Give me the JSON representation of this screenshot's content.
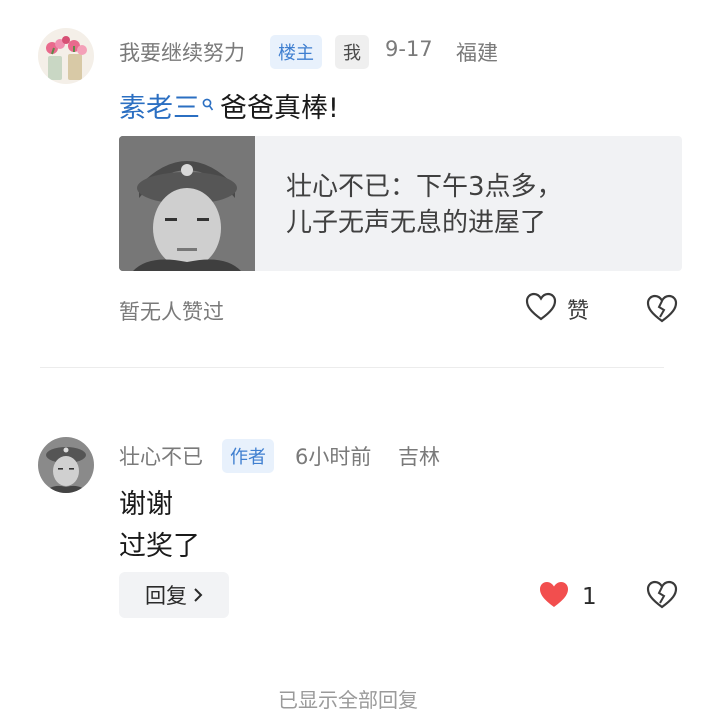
{
  "comment1": {
    "username": "我要继续努力",
    "badge_floor": "楼主",
    "badge_me": "我",
    "date": "9-17",
    "location": "福建",
    "mention": "素老三",
    "text": "爸爸真棒!",
    "quote": {
      "line1": "壮心不已：下午3点多，",
      "line2": "儿子无声无息的进屋了"
    },
    "likes_status": "暂无人赞过",
    "like_label": "赞",
    "colors": {
      "mention": "#2b6fc2",
      "tag_bg": "#e8f1fc",
      "tag_text": "#3f7fd0"
    }
  },
  "comment2": {
    "username": "壮心不已",
    "badge_author": "作者",
    "time": "6小时前",
    "location": "吉林",
    "text_line1": "谢谢",
    "text_line2": "过奖了",
    "reply_label": "回复",
    "like_count": "1",
    "colors": {
      "heart": "#f24e4e"
    }
  },
  "footer": {
    "text": "已显示全部回复"
  },
  "icons": [
    "heart-outline-icon",
    "broken-heart-icon",
    "heart-filled-icon",
    "chevron-right-icon",
    "search-icon"
  ]
}
